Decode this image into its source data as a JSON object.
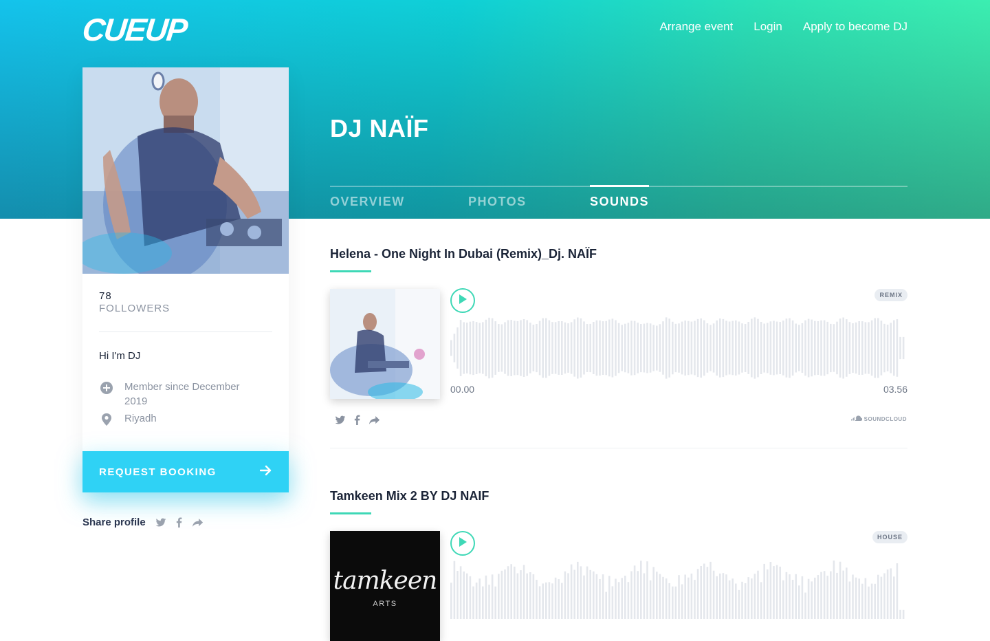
{
  "header": {
    "logo": "CUEUP",
    "nav": [
      "Arrange event",
      "Login",
      "Apply to become DJ"
    ]
  },
  "profile": {
    "name": "DJ NAÏF",
    "followers_count": "78",
    "followers_label": "FOLLOWERS",
    "bio": "Hi I'm DJ",
    "member_since": "Member since December 2019",
    "location": "Riyadh",
    "booking_label": "REQUEST BOOKING",
    "share_label": "Share profile"
  },
  "tabs": [
    {
      "label": "OVERVIEW",
      "active": false
    },
    {
      "label": "PHOTOS",
      "active": false
    },
    {
      "label": "SOUNDS",
      "active": true
    }
  ],
  "tracks": [
    {
      "title": "Helena - One Night In Dubai (Remix)_Dj. NAÏF",
      "tag": "REMIX",
      "time_start": "00.00",
      "time_end": "03.56",
      "source": "SOUNDCLOUD"
    },
    {
      "title": "Tamkeen Mix 2 BY DJ NAIF",
      "tag": "HOUSE",
      "cover_text": "tamkeen",
      "cover_subtext": "ARTS"
    }
  ],
  "colors": {
    "accent_green": "#3ed8b6",
    "booking_cyan": "#2fd2f5",
    "waveform": "#e4e7ec"
  },
  "icons": [
    "twitter-icon",
    "facebook-icon",
    "share-arrow-icon",
    "plus-circle-icon",
    "location-pin-icon",
    "play-icon",
    "arrow-right-icon",
    "soundcloud-icon"
  ]
}
